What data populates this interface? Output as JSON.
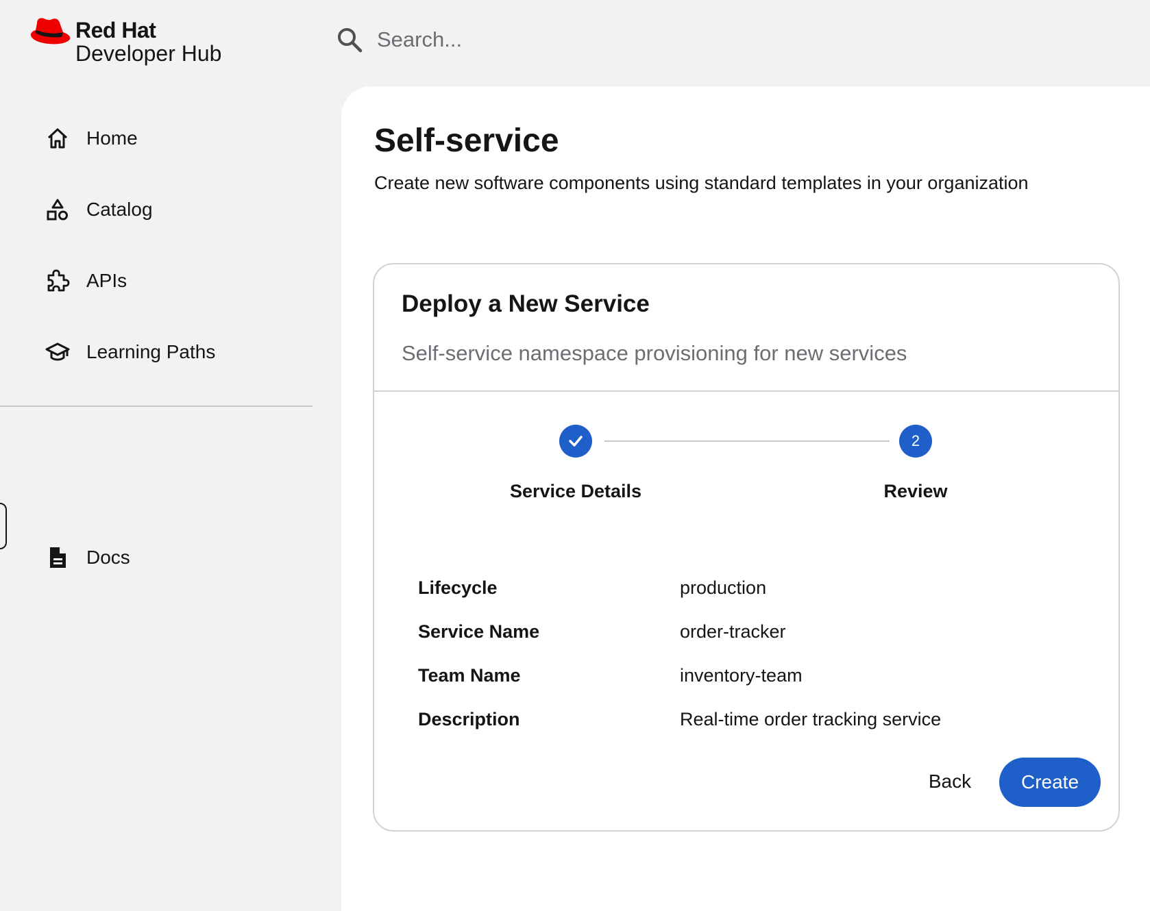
{
  "brand": {
    "name": "Red Hat",
    "product": "Developer Hub",
    "logo_icon": "red-hat-fedora-icon",
    "accent_color": "#ee0000"
  },
  "search": {
    "placeholder": "Search...",
    "icon": "search-icon"
  },
  "sidebar": {
    "items": [
      {
        "label": "Home",
        "icon": "home-icon"
      },
      {
        "label": "Catalog",
        "icon": "catalog-shapes-icon"
      },
      {
        "label": "APIs",
        "icon": "puzzle-icon"
      },
      {
        "label": "Learning Paths",
        "icon": "graduation-cap-icon"
      }
    ],
    "secondary": [
      {
        "label": "Docs",
        "icon": "document-icon"
      }
    ]
  },
  "page": {
    "title": "Self-service",
    "subtitle": "Create new software components using standard templates in your organization"
  },
  "card": {
    "title": "Deploy a New Service",
    "subtitle": "Self-service namespace provisioning for new services",
    "steps": [
      {
        "label": "Service Details",
        "state": "completed",
        "icon": "check-icon"
      },
      {
        "label": "Review",
        "state": "active",
        "number": "2"
      }
    ],
    "review": [
      {
        "key": "Lifecycle",
        "value": "production"
      },
      {
        "key": "Service Name",
        "value": "order-tracker"
      },
      {
        "key": "Team Name",
        "value": "inventory-team"
      },
      {
        "key": "Description",
        "value": "Real-time order tracking service"
      }
    ],
    "actions": {
      "back_label": "Back",
      "create_label": "Create"
    }
  },
  "colors": {
    "primary": "#1f5fc9",
    "background": "#f2f2f2",
    "muted_text": "#6a6e73"
  }
}
